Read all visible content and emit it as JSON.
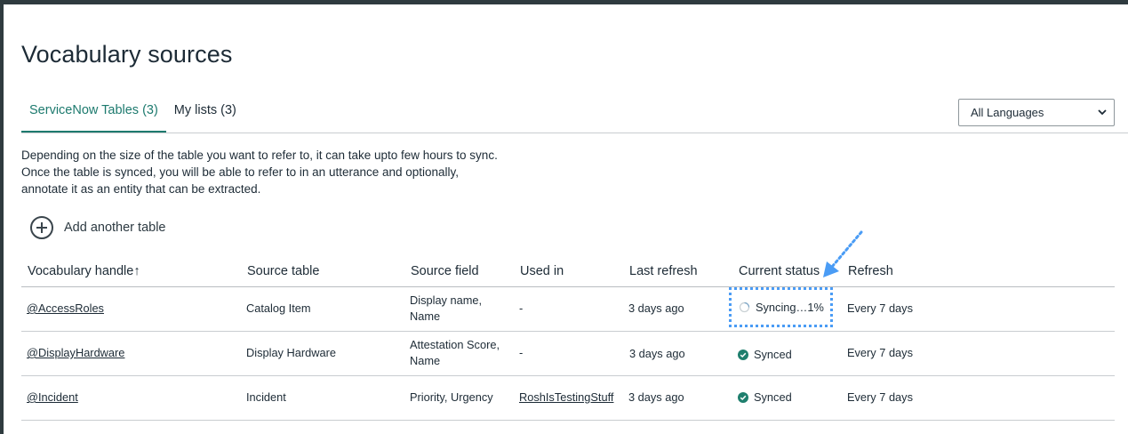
{
  "page": {
    "title": "Vocabulary sources"
  },
  "tabs": [
    {
      "label": "ServiceNow Tables (3)",
      "active": true
    },
    {
      "label": "My lists (3)",
      "active": false
    }
  ],
  "language_select": {
    "value": "All Languages"
  },
  "description": "Depending on the size of the table you want to refer to, it can take upto few hours to sync. Once the table is synced, you will be able to refer to in an utterance and optionally, annotate it as an entity that can be extracted.",
  "add_table": {
    "label": "Add another table",
    "icon": "plus-circle-icon"
  },
  "table": {
    "columns": [
      "Vocabulary handle",
      "Source table",
      "Source field",
      "Used in",
      "Last refresh",
      "Current status",
      "Refresh"
    ],
    "sort_indicator": "↑",
    "rows": [
      {
        "handle": "@AccessRoles",
        "source_table": "Catalog Item",
        "source_field_1": "Display name,",
        "source_field_2": "Name",
        "used_in": "-",
        "last_refresh": "3 days ago",
        "status": "Syncing…1%",
        "refresh": "Every 7 days"
      },
      {
        "handle": "@DisplayHardware",
        "source_table": "Display Hardware",
        "source_field_1": "Attestation Score,",
        "source_field_2": "Name",
        "used_in": "-",
        "last_refresh": "3 days ago",
        "status": "Synced",
        "refresh": "Every 7 days"
      },
      {
        "handle": "@Incident",
        "source_table": "Incident",
        "source_field_1": "Priority, Urgency",
        "source_field_2": "",
        "used_in": "RoshIsTestingStuff",
        "last_refresh": "3 days ago",
        "status": "Synced",
        "refresh": "Every 7 days"
      }
    ]
  },
  "colors": {
    "accent": "#1d7a6e",
    "synced": "#1f7f6e",
    "annotation": "#4a9cf5"
  }
}
